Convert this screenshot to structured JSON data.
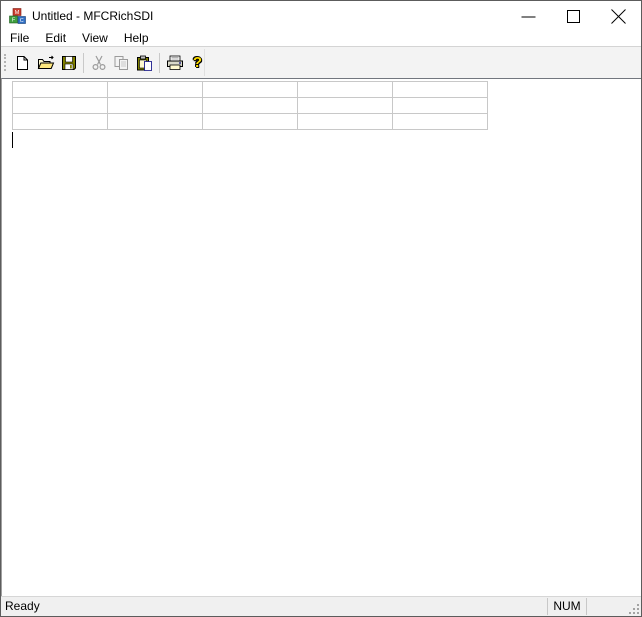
{
  "window": {
    "title": "Untitled - MFCRichSDI",
    "app_icon": "mfc-cubes-icon"
  },
  "titlebar_controls": [
    {
      "name": "minimize",
      "glyph": "—"
    },
    {
      "name": "maximize",
      "glyph": "□"
    },
    {
      "name": "close",
      "glyph": "✕"
    }
  ],
  "menu": {
    "items": [
      "File",
      "Edit",
      "View",
      "Help"
    ]
  },
  "toolbar": {
    "buttons": [
      {
        "name": "new",
        "icon": "new-document-icon",
        "enabled": true
      },
      {
        "name": "open",
        "icon": "open-folder-icon",
        "enabled": true
      },
      {
        "name": "save",
        "icon": "save-floppy-icon",
        "enabled": true
      },
      {
        "name": "cut",
        "icon": "cut-scissors-icon",
        "enabled": false
      },
      {
        "name": "copy",
        "icon": "copy-pages-icon",
        "enabled": false
      },
      {
        "name": "paste",
        "icon": "paste-clipboard-icon",
        "enabled": true
      },
      {
        "name": "print",
        "icon": "print-printer-icon",
        "enabled": true
      },
      {
        "name": "help",
        "icon": "help-question-icon",
        "enabled": true
      }
    ],
    "help_glyph": "?"
  },
  "editor": {
    "table": {
      "rows": 3,
      "cols": 5,
      "cells_empty": true
    },
    "caret_visible": true
  },
  "statusbar": {
    "message": "Ready",
    "num_indicator": "NUM"
  },
  "colors": {
    "window_border": "#5c5c5c",
    "client_edge": "#72767e",
    "table_border": "#c8c8c8",
    "toolbar_bg": "#f3f3f3",
    "statusbar_bg": "#f0f0f0",
    "icon_olive": "#808000",
    "icon_yellow": "#ffe000",
    "disabled_gray": "#9b9b9b"
  }
}
